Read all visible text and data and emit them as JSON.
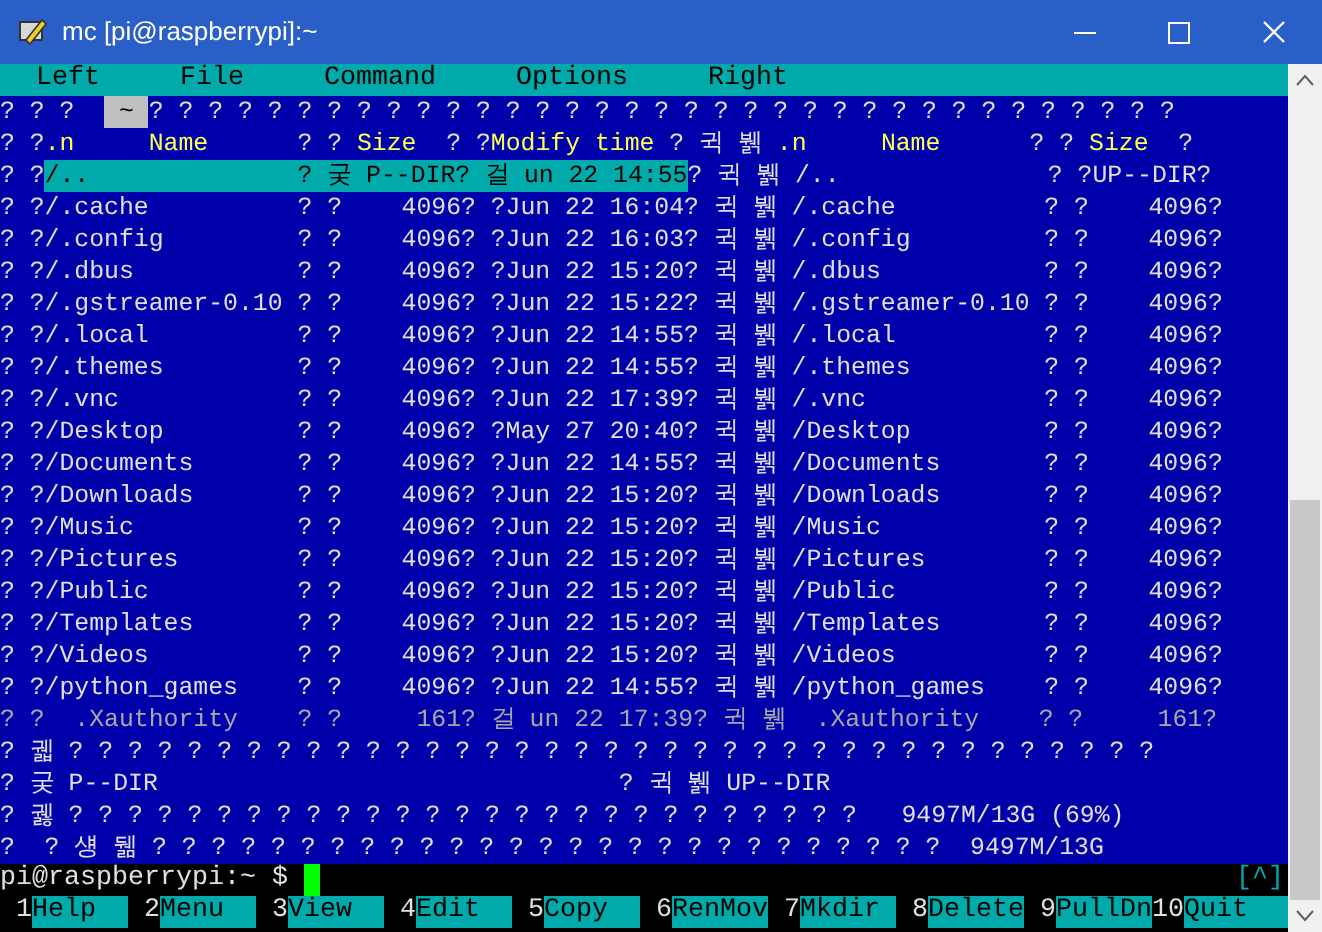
{
  "window": {
    "title": "mc [pi@raspberrypi]:~"
  },
  "menu_bar": [
    "Left",
    "File",
    "Command",
    "Options",
    "Right"
  ],
  "lines": [
    [
      {
        "text": "? ? ?  ",
        "kind": "normal"
      },
      {
        "text": " ~ ",
        "kind": "tab"
      },
      {
        "text": "? ? ? ? ? ? ? ? ? ? ? ? ? ? ? ? ? ? ? ? ? ? ? ? ? ? ? ? ? ? ? ? ? ? ?",
        "kind": "normal"
      }
    ],
    [
      {
        "text": "? ?",
        "kind": "normal"
      },
      {
        "text": ".n     Name      ",
        "kind": "header"
      },
      {
        "text": "? ? ",
        "kind": "normal"
      },
      {
        "text": "Size",
        "kind": "header"
      },
      {
        "text": "  ? ?",
        "kind": "normal"
      },
      {
        "text": "Modify time",
        "kind": "header"
      },
      {
        "text": " ? 귁 뷁 ",
        "kind": "normal"
      },
      {
        "text": ".n     Name",
        "kind": "header"
      },
      {
        "text": "      ? ? ",
        "kind": "normal"
      },
      {
        "text": "Size",
        "kind": "header"
      },
      {
        "text": "  ?",
        "kind": "normal"
      }
    ],
    [
      {
        "text": "? ?",
        "kind": "normal"
      },
      {
        "text": "/..              ? 궂 P--DIR? 걸 un 22 14:55",
        "kind": "selected"
      },
      {
        "text": "? 귁 뷁 /..              ? ?UP--DIR?",
        "kind": "normal"
      }
    ],
    [
      {
        "text": "? ?/.cache          ? ?    4096? ?Jun 22 16:04? 귁 뷁 /.cache          ? ?    4096?",
        "kind": "normal"
      }
    ],
    [
      {
        "text": "? ?/.config         ? ?    4096? ?Jun 22 16:03? 귁 뷁 /.config         ? ?    4096?",
        "kind": "normal"
      }
    ],
    [
      {
        "text": "? ?/.dbus           ? ?    4096? ?Jun 22 15:20? 귁 뷁 /.dbus           ? ?    4096?",
        "kind": "normal"
      }
    ],
    [
      {
        "text": "? ?/.gstreamer-0.10 ? ?    4096? ?Jun 22 15:22? 귁 뷁 /.gstreamer-0.10 ? ?    4096?",
        "kind": "normal"
      }
    ],
    [
      {
        "text": "? ?/.local          ? ?    4096? ?Jun 22 14:55? 귁 뷁 /.local          ? ?    4096?",
        "kind": "normal"
      }
    ],
    [
      {
        "text": "? ?/.themes         ? ?    4096? ?Jun 22 14:55? 귁 뷁 /.themes         ? ?    4096?",
        "kind": "normal"
      }
    ],
    [
      {
        "text": "? ?/.vnc            ? ?    4096? ?Jun 22 17:39? 귁 뷁 /.vnc            ? ?    4096?",
        "kind": "normal"
      }
    ],
    [
      {
        "text": "? ?/Desktop         ? ?    4096? ?May 27 20:40? 귁 뷁 /Desktop         ? ?    4096?",
        "kind": "normal"
      }
    ],
    [
      {
        "text": "? ?/Documents       ? ?    4096? ?Jun 22 14:55? 귁 뷁 /Documents       ? ?    4096?",
        "kind": "normal"
      }
    ],
    [
      {
        "text": "? ?/Downloads       ? ?    4096? ?Jun 22 15:20? 귁 뷁 /Downloads       ? ?    4096?",
        "kind": "normal"
      }
    ],
    [
      {
        "text": "? ?/Music           ? ?    4096? ?Jun 22 15:20? 귁 뷁 /Music           ? ?    4096?",
        "kind": "normal"
      }
    ],
    [
      {
        "text": "? ?/Pictures        ? ?    4096? ?Jun 22 15:20? 귁 뷁 /Pictures        ? ?    4096?",
        "kind": "normal"
      }
    ],
    [
      {
        "text": "? ?/Public          ? ?    4096? ?Jun 22 15:20? 귁 뷁 /Public          ? ?    4096?",
        "kind": "normal"
      }
    ],
    [
      {
        "text": "? ?/Templates       ? ?    4096? ?Jun 22 15:20? 귁 뷁 /Templates       ? ?    4096?",
        "kind": "normal"
      }
    ],
    [
      {
        "text": "? ?/Videos          ? ?    4096? ?Jun 22 15:20? 귁 뷁 /Videos          ? ?    4096?",
        "kind": "normal"
      }
    ],
    [
      {
        "text": "? ?/python_games    ? ?    4096? ?Jun 22 14:55? 귁 뷁 /python_games    ? ?    4096?",
        "kind": "normal"
      }
    ],
    [
      {
        "text": "? ?  .Xauthority    ? ?     161? 걸 un 22 17:39? 귁 뷁  .Xauthority    ? ?     161?",
        "kind": "dim"
      }
    ],
    [
      {
        "text": "? 궯 ? ? ? ? ? ? ? ? ? ? ? ? ? ? ? ? ? ? ? ? ? ? ? ? ? ? ? ? ? ? ? ? ? ? ? ? ?",
        "kind": "normal"
      }
    ],
    [
      {
        "text": "? 궂 P--DIR                               ? 귁 뷁 UP--DIR",
        "kind": "normal"
      }
    ],
    [
      {
        "text": "? 궳 ? ? ? ? ? ? ? ? ? ? ? ? ? ? ? ? ? ? ? ? ? ? ? ? ? ? ?   9497M/13G (69%)",
        "kind": "normal"
      }
    ],
    [
      {
        "text": "?  ? 섕 뒒 ? ? ? ? ? ? ? ? ? ? ? ? ? ? ? ? ? ? ? ? ? ? ? ? ? ? ?  9497M/13G",
        "kind": "normal"
      }
    ]
  ],
  "prompt": {
    "text": "pi@raspberrypi:~ $ ",
    "scroll_indicator": "[^]"
  },
  "function_keys": [
    {
      "number": "1",
      "label": "Help"
    },
    {
      "number": "2",
      "label": "Menu"
    },
    {
      "number": "3",
      "label": "View"
    },
    {
      "number": "4",
      "label": "Edit"
    },
    {
      "number": "5",
      "label": "Copy"
    },
    {
      "number": "6",
      "label": "RenMov"
    },
    {
      "number": "7",
      "label": "Mkdir"
    },
    {
      "number": "8",
      "label": "Delete"
    },
    {
      "number": "9",
      "label": "PullDn"
    },
    {
      "number": "10",
      "label": "Quit"
    }
  ]
}
